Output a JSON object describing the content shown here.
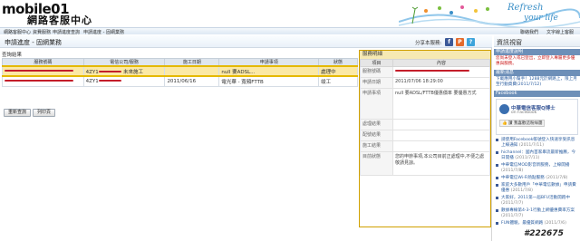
{
  "header": {
    "logo_text": "mobile01",
    "logo_subtitle": "網路客服中心",
    "banner_line1": "Refresh",
    "banner_line2": "your life"
  },
  "nav": {
    "items": [
      "網路客服中心",
      "資費服務",
      "申請進度查詢",
      "申請進度 - 固網業務"
    ],
    "right_items": [
      "聯絡我們",
      "文字線上客服"
    ]
  },
  "page": {
    "title": "申請進度 - 固網業務",
    "share_label": "分享本服務:",
    "section_label": "查詢結果"
  },
  "results": {
    "headers": [
      "服務號碼",
      "電信公司/服務",
      "施工日期",
      "申請事項",
      "狀態"
    ],
    "rows": [
      {
        "c1": "",
        "c2": "4ZY1",
        "c2b": "未來施工",
        "c3": "",
        "c4": "null 要ADSL...",
        "c5": "處理中"
      },
      {
        "c1": "",
        "c2": "4ZY1",
        "c2b": "",
        "c3": "2011/06/16",
        "c4": "申請寬頻(不含...)",
        "c5": "竣工"
      }
    ],
    "row2_extra": "電光華 - 寬頻FTTB"
  },
  "buttons": {
    "reset": "重新查詢",
    "print": "列印頁"
  },
  "detail": {
    "title": "服務明細",
    "col_item": "項目",
    "col_content": "內容",
    "rows": [
      {
        "k": "服務號碼",
        "v": ""
      },
      {
        "k": "申請日期",
        "v": "2011/07/06 18:29:00"
      },
      {
        "k": "申請事項",
        "v": "null 要ADSL/FTTB優惠價率 要優惠方式"
      },
      {
        "k": "處理結果",
        "v": ""
      },
      {
        "k": "配號結果",
        "v": ""
      },
      {
        "k": "施工結果",
        "v": ""
      },
      {
        "k": "目前狀態",
        "v": "您的申辦事項,本公司目前正處理中,不便之處敬請見諒。"
      }
    ]
  },
  "sidebar": {
    "title": "資訊視窗",
    "notice_head": "申請進度說明",
    "notice_text": "您尚未登入或已登出，立即登入專屬更多優惠與服務。",
    "promo_head": "最新消息",
    "promo_text": "下載應用小幫手！1288元於網路上，限上月至行動資費(2011/7/12)",
    "fb_head": "Facebook",
    "fb_title": "中華電信客服Q博士",
    "fb_sub": "on Facebook",
    "fb_like": "讚",
    "fb_like_text": "我喜歡這粉絲團",
    "fb_items": [
      {
        "text": "請使用Facebook帳號登入快速享受訊息上線通知",
        "date": "(2011/7/11)"
      },
      {
        "text": "hichannel：國內首家串流最新推薦，今日開播",
        "date": "(2011/7/11)"
      },
      {
        "text": "中華電信MOD影音新服務，上線開播",
        "date": "(2011/7/8)"
      },
      {
        "text": "中華電信Wi-Fi熱點服務",
        "date": "(2011/7/8)"
      },
      {
        "text": "家庭大多數用戶「中華電信數據」申請費優惠",
        "date": "(2011/7/8)"
      },
      {
        "text": "大家好，2011第一屆BFU活動開跑中",
        "date": "(2011/7/7)"
      },
      {
        "text": "數據專線第4-3-1行動上網優惠費率方案",
        "date": "(2011/7/7)"
      },
      {
        "text": "FUN體驗，最優質網路",
        "date": "(2011/7/6)"
      }
    ]
  },
  "watermark": "#222675",
  "colors": {
    "selected_row": "#fbe9a5",
    "selected_border": "#e5b900",
    "accent_blue": "#3a8fc7",
    "redact": "#c41e2a"
  }
}
